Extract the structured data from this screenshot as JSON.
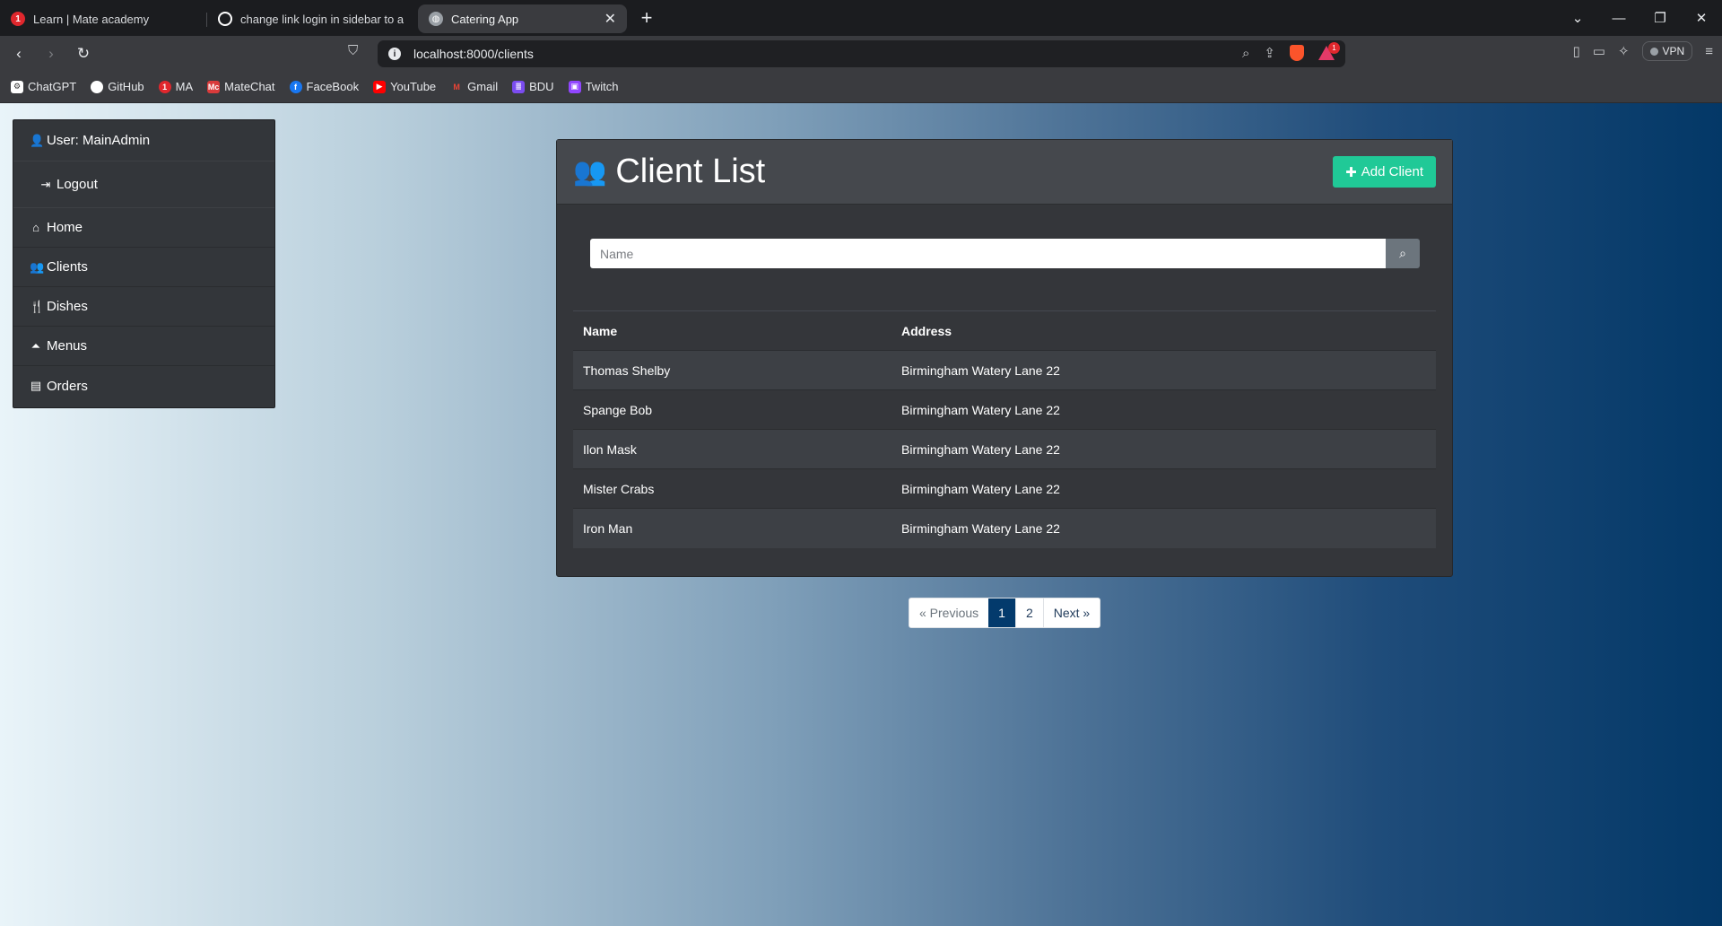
{
  "browser": {
    "tabs": [
      {
        "title": "Learn | Mate academy",
        "favicon": "mate-academy-icon",
        "badge": "1",
        "color": "#e0272d"
      },
      {
        "title": "change link login in sidebar to avoid",
        "favicon": "github-icon",
        "color": "#ffffff"
      },
      {
        "title": "Catering App",
        "favicon": "globe-icon",
        "color": "#9aa0a6",
        "active": true
      }
    ],
    "address": "localhost:8000/clients",
    "rewards_badge": "1",
    "vpn_label": "VPN",
    "bookmarks": [
      {
        "label": "ChatGPT",
        "color": "#ffffff"
      },
      {
        "label": "GitHub",
        "color": "#ffffff"
      },
      {
        "label": "MA",
        "badge": "1",
        "color": "#e0272d"
      },
      {
        "label": "MateChat",
        "badge": "Mc",
        "color": "#d93b3b"
      },
      {
        "label": "FaceBook",
        "color": "#1877f2"
      },
      {
        "label": "YouTube",
        "color": "#ff0000"
      },
      {
        "label": "Gmail",
        "color": "#ea4335"
      },
      {
        "label": "BDU",
        "color": "#7b4cf0"
      },
      {
        "label": "Twitch",
        "color": "#9146ff"
      }
    ]
  },
  "sidebar": {
    "user": "User: MainAdmin",
    "logout": "Logout",
    "items": [
      {
        "label": "Home",
        "icon": "home-icon"
      },
      {
        "label": "Clients",
        "icon": "users-icon"
      },
      {
        "label": "Dishes",
        "icon": "utensils-icon"
      },
      {
        "label": "Menus",
        "icon": "cloche-icon"
      },
      {
        "label": "Orders",
        "icon": "receipt-icon"
      }
    ]
  },
  "main": {
    "title": "Client List",
    "add_button": "Add Client",
    "search_placeholder": "Name",
    "table": {
      "headers": [
        "Name",
        "Address"
      ],
      "rows": [
        [
          "Thomas Shelby",
          "Birmingham Watery Lane 22"
        ],
        [
          "Spange Bob",
          "Birmingham Watery Lane 22"
        ],
        [
          "Ilon Mask",
          "Birmingham Watery Lane 22"
        ],
        [
          "Mister Crabs",
          "Birmingham Watery Lane 22"
        ],
        [
          "Iron Man",
          "Birmingham Watery Lane 22"
        ]
      ]
    },
    "pagination": {
      "previous": "« Previous",
      "pages": [
        "1",
        "2"
      ],
      "current": "1",
      "next": "Next »"
    }
  },
  "colors": {
    "accent_button": "#20c997",
    "active_page": "#033a6c",
    "card_bg": "#34363a"
  }
}
